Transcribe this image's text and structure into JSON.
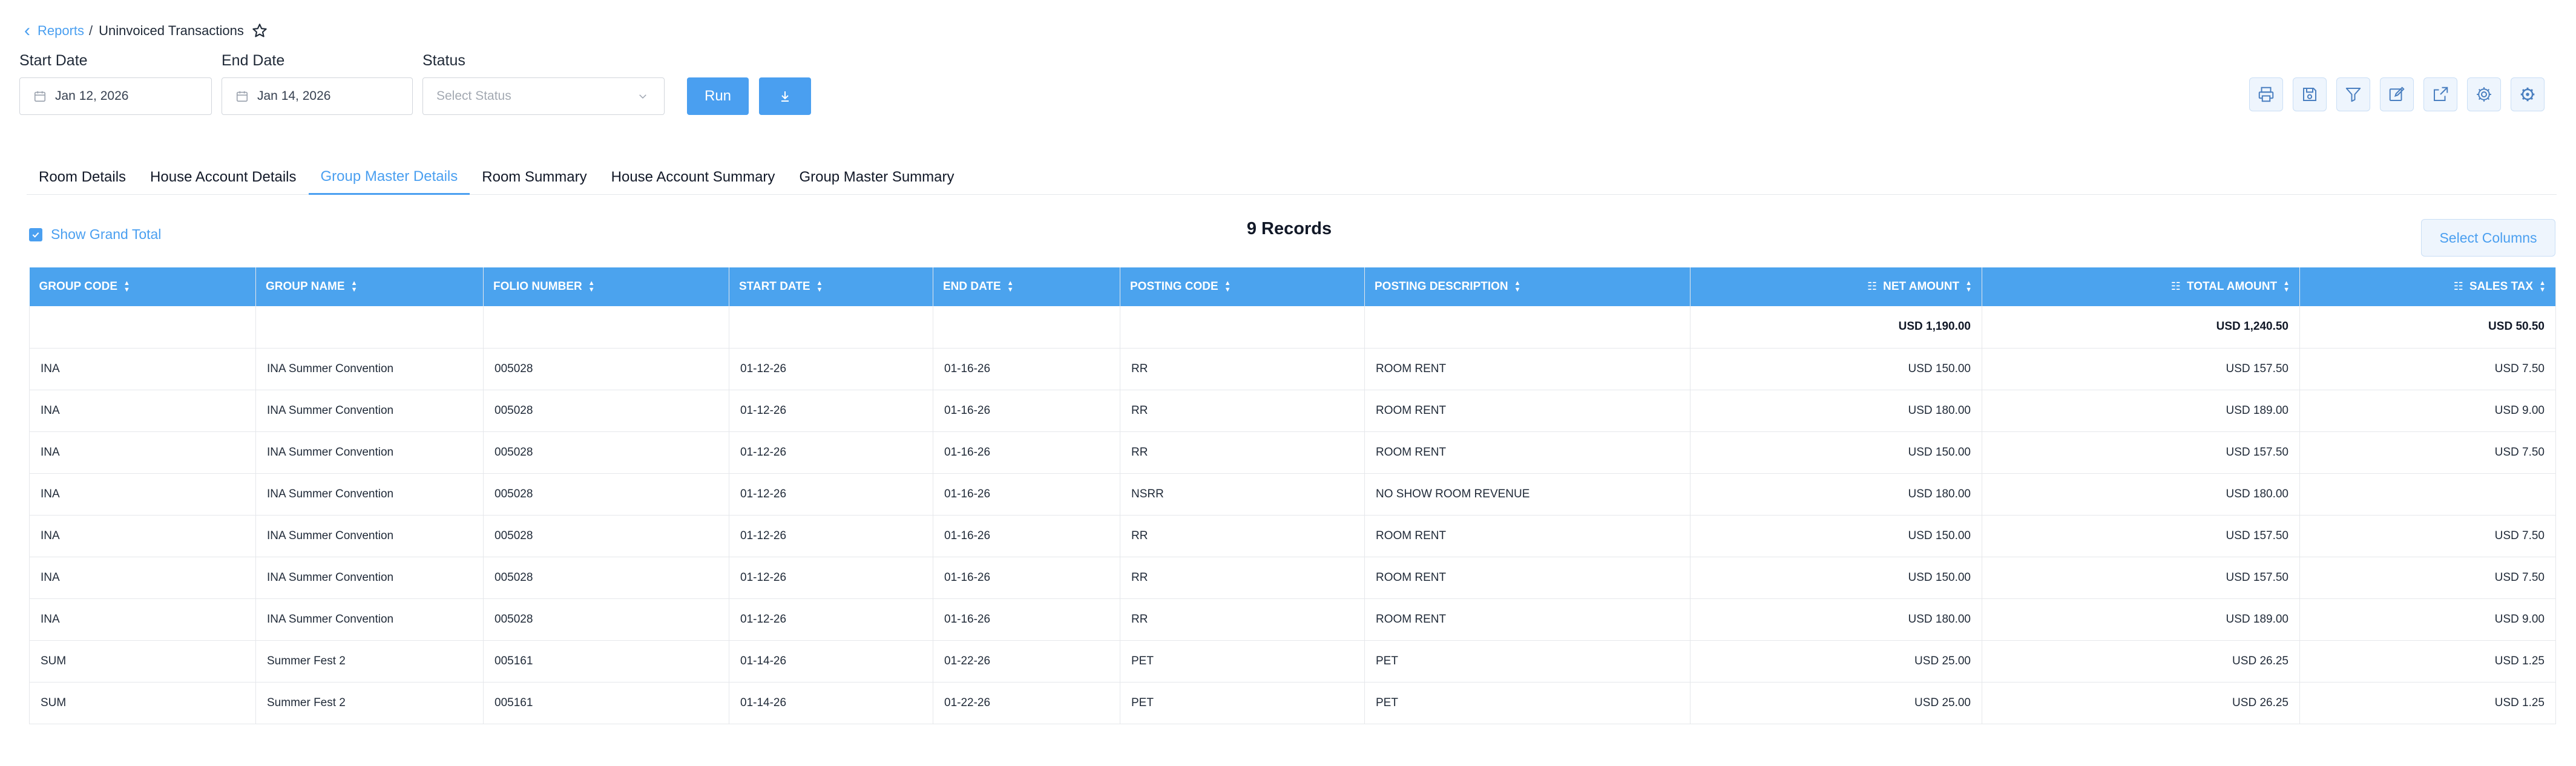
{
  "breadcrumb": {
    "parent": "Reports",
    "separator": "/",
    "current": "Uninvoiced Transactions"
  },
  "filters": {
    "start_date": {
      "label": "Start Date",
      "value": "Jan 12, 2026"
    },
    "end_date": {
      "label": "End Date",
      "value": "Jan 14, 2026"
    },
    "status": {
      "label": "Status",
      "placeholder": "Select Status"
    }
  },
  "buttons": {
    "run": "Run"
  },
  "toolbar_icons": [
    "print-icon",
    "save-icon",
    "filter-icon",
    "edit-icon",
    "export-icon",
    "settings-icon",
    "advanced-settings-icon"
  ],
  "tabs": [
    "Room Details",
    "House Account Details",
    "Group Master Details",
    "Room Summary",
    "House Account Summary",
    "Group Master Summary"
  ],
  "active_tab": "Group Master Details",
  "grand_total_label": "Show Grand Total",
  "records_label": "9 Records",
  "select_columns": "Select Columns",
  "colors": {
    "accent": "#4a9ff0",
    "header_bg": "#4ba3ee"
  },
  "table": {
    "columns": [
      "GROUP CODE",
      "GROUP NAME",
      "FOLIO NUMBER",
      "START DATE",
      "END DATE",
      "POSTING CODE",
      "POSTING DESCRIPTION",
      "NET AMOUNT",
      "TOTAL AMOUNT",
      "SALES TAX"
    ],
    "totals": [
      "",
      "",
      "",
      "",
      "",
      "",
      "",
      "USD 1,190.00",
      "USD 1,240.50",
      "USD 50.50"
    ],
    "rows": [
      [
        "INA",
        "INA Summer Convention",
        "005028",
        "01-12-26",
        "01-16-26",
        "RR",
        "ROOM RENT",
        "USD 150.00",
        "USD 157.50",
        "USD 7.50"
      ],
      [
        "INA",
        "INA Summer Convention",
        "005028",
        "01-12-26",
        "01-16-26",
        "RR",
        "ROOM RENT",
        "USD 180.00",
        "USD 189.00",
        "USD 9.00"
      ],
      [
        "INA",
        "INA Summer Convention",
        "005028",
        "01-12-26",
        "01-16-26",
        "RR",
        "ROOM RENT",
        "USD 150.00",
        "USD 157.50",
        "USD 7.50"
      ],
      [
        "INA",
        "INA Summer Convention",
        "005028",
        "01-12-26",
        "01-16-26",
        "NSRR",
        "NO SHOW ROOM REVENUE",
        "USD 180.00",
        "USD 180.00",
        ""
      ],
      [
        "INA",
        "INA Summer Convention",
        "005028",
        "01-12-26",
        "01-16-26",
        "RR",
        "ROOM RENT",
        "USD 150.00",
        "USD 157.50",
        "USD 7.50"
      ],
      [
        "INA",
        "INA Summer Convention",
        "005028",
        "01-12-26",
        "01-16-26",
        "RR",
        "ROOM RENT",
        "USD 150.00",
        "USD 157.50",
        "USD 7.50"
      ],
      [
        "INA",
        "INA Summer Convention",
        "005028",
        "01-12-26",
        "01-16-26",
        "RR",
        "ROOM RENT",
        "USD 180.00",
        "USD 189.00",
        "USD 9.00"
      ],
      [
        "SUM",
        "Summer Fest 2",
        "005161",
        "01-14-26",
        "01-22-26",
        "PET",
        "PET",
        "USD 25.00",
        "USD 26.25",
        "USD 1.25"
      ],
      [
        "SUM",
        "Summer Fest 2",
        "005161",
        "01-14-26",
        "01-22-26",
        "PET",
        "PET",
        "USD 25.00",
        "USD 26.25",
        "USD 1.25"
      ]
    ]
  }
}
